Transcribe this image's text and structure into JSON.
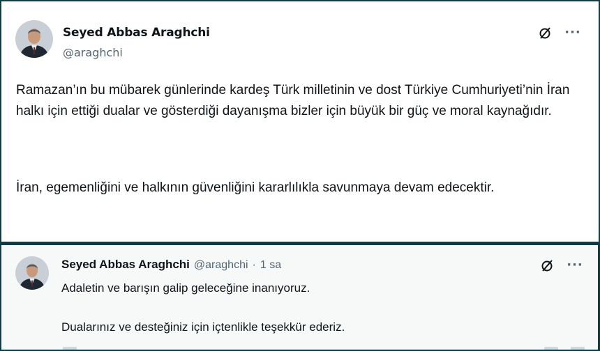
{
  "post1": {
    "author_name": "Seyed Abbas Araghchi",
    "author_handle": "@araghchi",
    "paragraph_1": "Ramazan’ın bu mübarek günlerinde kardeş Türk milletinin ve dost Türkiye Cumhuriyeti’nin İran halkı için ettiği dualar ve gösterdiği dayanışma bizler için büyük bir güç ve moral kaynağıdır.",
    "paragraph_2": "İran, egemenliğini ve halkının güvenliğini kararlılıkla savunmaya devam edecektir.",
    "more_label": "···"
  },
  "post2": {
    "author_name": "Seyed Abbas Araghchi",
    "author_handle": "@araghchi",
    "separator": "·",
    "time": "1 sa",
    "line_1": "Adaletin ve barışın galip geleceğine inanıyoruz.",
    "line_2": "Dualarınız ve desteğiniz için içtenlikle teşekkür ederiz.",
    "more_label": "···"
  },
  "colors": {
    "frame_background": "#0f3d47",
    "text_primary": "#0f1419",
    "text_secondary": "#536471"
  },
  "icons": [
    "grok-icon",
    "more-icon"
  ]
}
